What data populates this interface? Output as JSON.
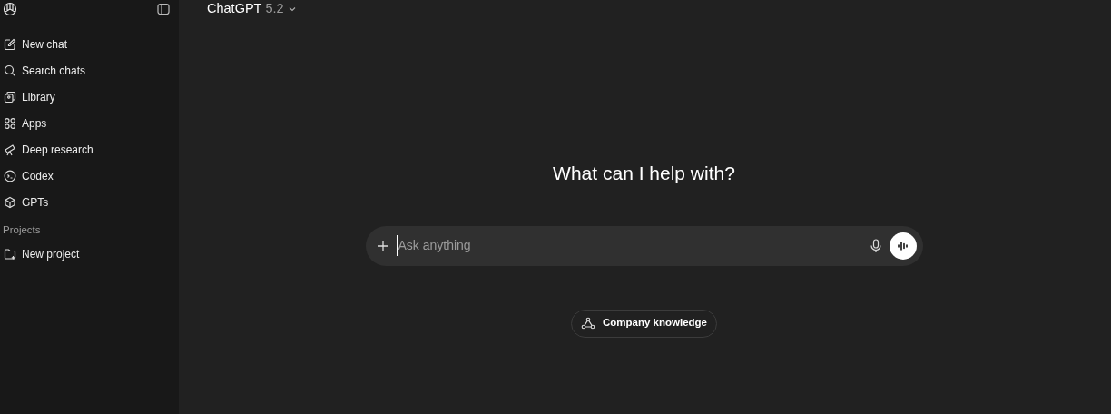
{
  "sidebar": {
    "items": [
      {
        "label": "New chat"
      },
      {
        "label": "Search chats"
      },
      {
        "label": "Library"
      },
      {
        "label": "Apps"
      },
      {
        "label": "Deep research"
      },
      {
        "label": "Codex"
      },
      {
        "label": "GPTs"
      }
    ],
    "projects": {
      "heading": "Projects",
      "items": [
        {
          "label": "New project"
        }
      ]
    }
  },
  "header": {
    "title": "ChatGPT",
    "version": "5.2"
  },
  "main": {
    "heading": "What can I help with?",
    "composer": {
      "placeholder": "Ask anything"
    },
    "chip": "Company knowledge"
  }
}
